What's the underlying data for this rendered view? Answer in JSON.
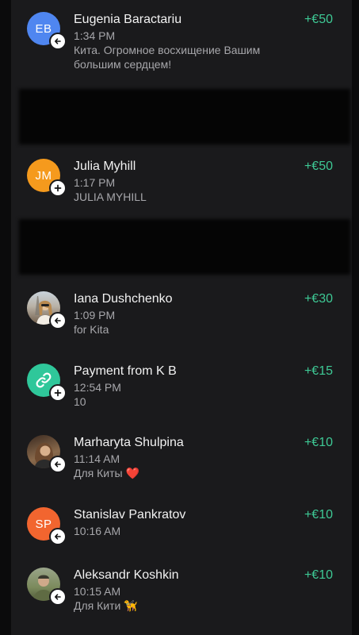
{
  "colors": {
    "background": "#1a1a1c",
    "amount_positive": "#3ec995",
    "secondary_text": "#a7a7ab"
  },
  "transactions": [
    {
      "name": "Eugenia Baractariu",
      "initials": "EB",
      "avatar_color": "#4f86f0",
      "time": "1:34 PM",
      "note": "Кита. Огромное восхищение Вашим\nбольшим сердцем!",
      "amount": "+€50",
      "badge_icon": "arrow-left-icon"
    },
    {
      "name": "Julia Myhill",
      "initials": "JM",
      "avatar_color": "#f59a1d",
      "time": "1:17 PM",
      "note": "JULIA MYHILL",
      "amount": "+€50",
      "badge_icon": "plus-icon"
    },
    {
      "name": "Iana Dushchenko",
      "initials": "",
      "avatar_color": "#b8b6b0",
      "time": "1:09 PM",
      "note": "for Kita",
      "amount": "+€30",
      "badge_icon": "arrow-left-icon"
    },
    {
      "name": "Payment from K B",
      "initials": "",
      "avatar_color": "#2fc79a",
      "time": "12:54 PM",
      "note": "10",
      "amount": "+€15",
      "badge_icon": "plus-icon"
    },
    {
      "name": "Marharyta Shulpina",
      "initials": "",
      "avatar_color": "#6b5440",
      "time": "11:14 AM",
      "note": "Для Киты",
      "note_emoji": "❤️",
      "amount": "+€10",
      "badge_icon": "arrow-left-icon"
    },
    {
      "name": "Stanislav Pankratov",
      "initials": "SP",
      "avatar_color": "#f2652f",
      "time": "10:16 AM",
      "note": "",
      "amount": "+€10",
      "badge_icon": "arrow-left-icon"
    },
    {
      "name": "Aleksandr Koshkin",
      "initials": "",
      "avatar_color": "#7b8a5c",
      "time": "10:15 AM",
      "note": "Для Кити",
      "note_emoji": "🦮",
      "amount": "+€10",
      "badge_icon": "arrow-left-icon"
    }
  ]
}
